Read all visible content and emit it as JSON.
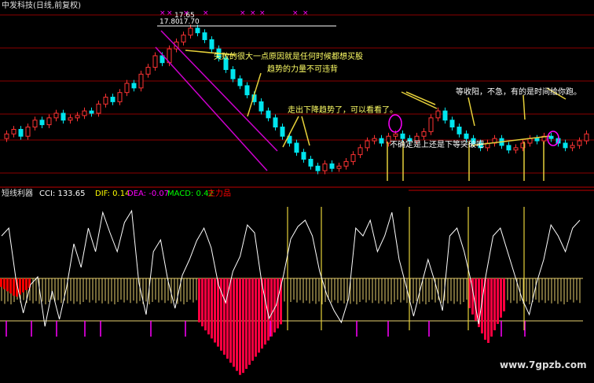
{
  "title_bar": {
    "text": "中发科技(日线,前复权)"
  },
  "price_labels": {
    "p1": "17.65",
    "p2": "17.80",
    "p3": "17.70"
  },
  "indicator_bar": {
    "name": "短线利器",
    "items": [
      {
        "text": "CCI: 133.65",
        "color": "#ffffff"
      },
      {
        "text": "DIF: 0.14",
        "color": "#ffff00"
      },
      {
        "text": "DEA: -0.07",
        "color": "#ff00ff"
      },
      {
        "text": "MACD: 0.42",
        "color": "#00ff00"
      },
      {
        "text": "主力品",
        "color": "#ff0000"
      }
    ]
  },
  "annotations": {
    "a1_line1": "失败的很大一点原因就是任何时候都想买股",
    "a1_line2": "趋势的力量不可违背",
    "a2": "走出下降趋势了，可以看看了。",
    "a3": "不确定是上还是下等突破吧",
    "a4": "等收阳，不急，有的是时间给你跑。"
  },
  "watermark": "www.7gpzb.com",
  "colors": {
    "up": "#ff3333",
    "down": "#00e5ee",
    "grid": "#8b0000",
    "channel": "#cc00cc",
    "arrow": "#e6d03a",
    "cci": "#ffffff",
    "volume": "#e8d070",
    "macd_neg": "#ff0000",
    "macd_pos": "#ff0040",
    "signal": "#ff00ff"
  },
  "chart_data": {
    "type": "candlestick",
    "series_close": [
      13.2,
      13.4,
      13.1,
      13.5,
      13.8,
      13.6,
      13.9,
      14.1,
      13.8,
      13.9,
      14.0,
      14.2,
      14.1,
      14.5,
      14.8,
      14.6,
      15.0,
      15.4,
      15.2,
      15.8,
      16.1,
      16.6,
      16.3,
      16.9,
      17.2,
      17.5,
      17.8,
      17.6,
      17.3,
      16.9,
      16.5,
      16.0,
      15.6,
      15.3,
      14.9,
      14.6,
      14.2,
      13.9,
      13.5,
      13.1,
      12.8,
      12.4,
      12.1,
      11.8,
      11.6,
      11.9,
      11.7,
      11.8,
      12.0,
      12.3,
      12.6,
      12.9,
      13.0,
      12.8,
      13.1,
      13.2,
      13.0,
      12.9,
      13.1,
      13.3,
      13.9,
      14.2,
      13.8,
      13.5,
      13.2,
      13.0,
      12.8,
      12.6,
      12.8,
      13.0,
      12.7,
      12.5,
      12.6,
      12.8,
      13.0,
      12.9,
      13.1,
      13.0,
      12.8,
      12.6,
      12.7,
      12.9,
      13.2
    ],
    "max": "17.80",
    "indicators": [
      "CCI",
      "DIF",
      "DEA",
      "MACD"
    ]
  }
}
